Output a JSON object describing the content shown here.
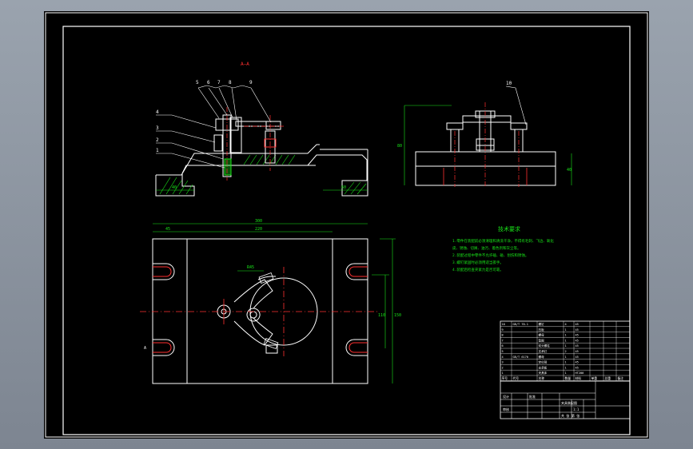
{
  "drawing": {
    "view_label": "A—A",
    "section_marker": "A",
    "top_callouts": [
      "5",
      "6",
      "7",
      "8",
      "9"
    ],
    "left_callouts": [
      "4",
      "3",
      "2",
      "1"
    ],
    "right_callout": "10",
    "dims": {
      "overall_width": "300",
      "inner_width": "220",
      "left_offset": "45",
      "arc_radius": "R45",
      "height_right": "150",
      "height_inner": "110",
      "side_height": "80",
      "base_left": "40",
      "base_right": "60",
      "side_base": "40"
    },
    "tech_req": {
      "title": "技术要求",
      "lines": [
        "1.零件在装配前必须清理和清洗干净，不得有毛刺、飞边、氧化",
        "皮、锈蚀、切屑、油污、着色剂和灰尘等。",
        "2.装配过程中零件不允许磕、碰、划伤和锈蚀。",
        "3.螺钉紧固时必须用适当扳手。",
        "4.装配后检查夹紧力是否可靠。"
      ]
    },
    "parts_table": {
      "rows": [
        [
          "10",
          "GB/T 70.1",
          "螺钉",
          "4",
          "45"
        ],
        [
          "9",
          "",
          "压板",
          "1",
          "45"
        ],
        [
          "8",
          "",
          "螺母",
          "1",
          "45"
        ],
        [
          "7",
          "",
          "垫圈",
          "1",
          "45"
        ],
        [
          "6",
          "",
          "双头螺柱",
          "1",
          "45"
        ],
        [
          "5",
          "",
          "支承钉",
          "2",
          "45"
        ],
        [
          "4",
          "GB/T 6170",
          "螺母",
          "1",
          "45"
        ],
        [
          "3",
          "",
          "定位销",
          "1",
          "45"
        ],
        [
          "2",
          "",
          "支承板",
          "1",
          "45"
        ],
        [
          "1",
          "",
          "夹具体",
          "1",
          "HT200"
        ]
      ],
      "header": [
        "序号",
        "代号",
        "名称",
        "数量",
        "材料",
        "单重",
        "总重",
        "备注"
      ]
    },
    "title_block": {
      "name": "夹具装配图",
      "scale": "1:1",
      "designer": "设计",
      "checker": "审核",
      "approver": "批准",
      "sheet": "共 张 第 张"
    }
  },
  "colors": {
    "line": "#ffffff",
    "dimension": "#19e619",
    "center": "#ff3030",
    "hatch": "#19e619",
    "leader": "#ffffff"
  }
}
